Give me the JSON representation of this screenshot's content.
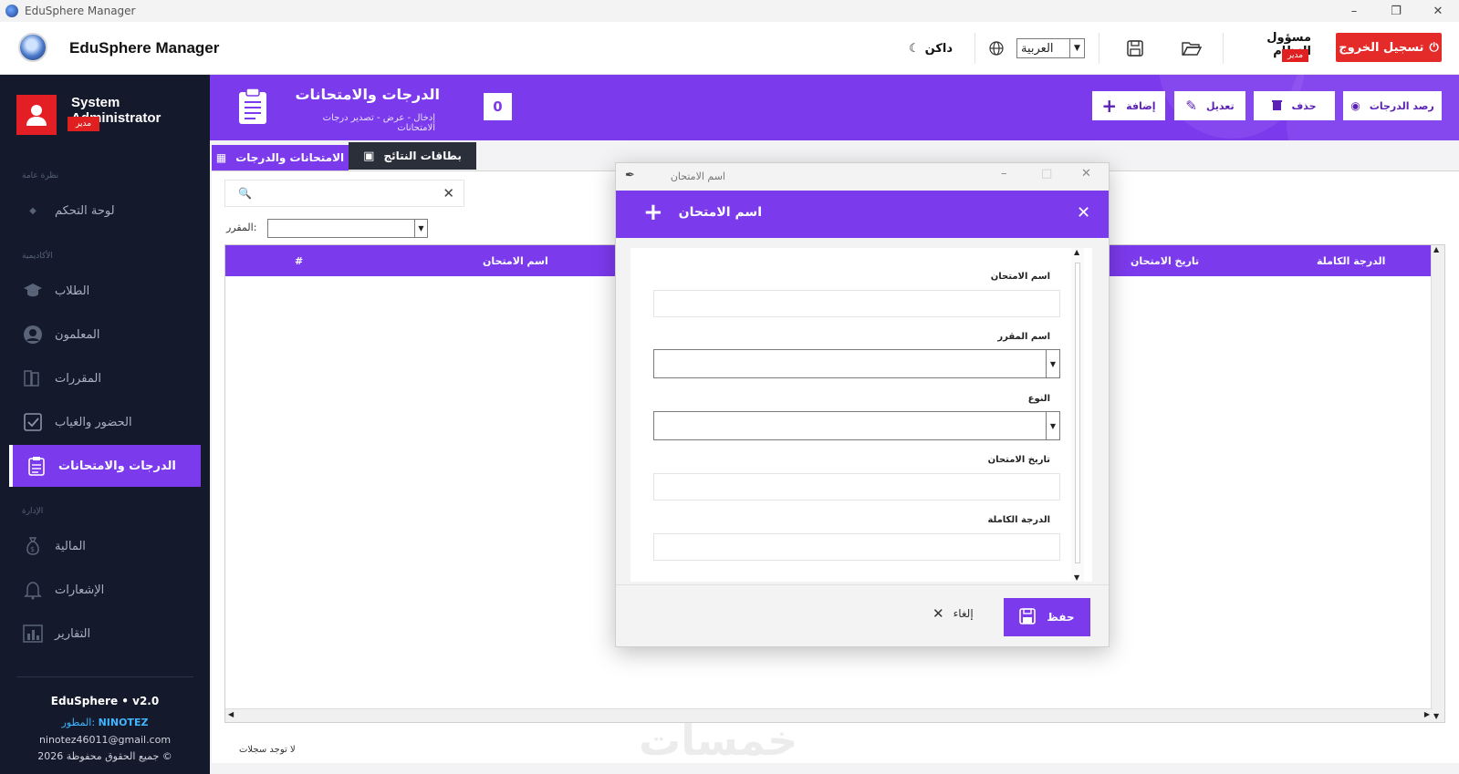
{
  "window": {
    "title": "EduSphere Manager"
  },
  "header": {
    "brand": "EduSphere Manager",
    "dark_mode_label": "داكن",
    "language": "العربية",
    "user_name": "مسؤول النظام",
    "user_role": "مدير",
    "logout_label": "تسجيل الخروج"
  },
  "sidebar": {
    "profile_name": "System Administrator",
    "profile_role": "مدير",
    "sections": [
      "نظرة عامة",
      "الأكاديمية",
      "الإدارة"
    ],
    "items": [
      {
        "label": "لوحة التحكم"
      },
      {
        "label": "الطلاب"
      },
      {
        "label": "المعلمون"
      },
      {
        "label": "المقررات"
      },
      {
        "label": "الحضور والغياب"
      },
      {
        "label": "الدرجات والامتحانات"
      },
      {
        "label": "المالية"
      },
      {
        "label": "الإشعارات"
      },
      {
        "label": "التقارير"
      }
    ],
    "footer": {
      "version": "EduSphere  •  v2.0",
      "developer_label": "المطور:",
      "developer_name": "NINOTEZ",
      "email": "ninotez46011@gmail.com",
      "copyright": "جميع الحقوق محفوظة 2026 ©"
    }
  },
  "page": {
    "title": "الدرجات والامتحانات",
    "subtitle": "إدخال - عرض - تصدير درجات الامتحانات",
    "count": "0",
    "toolbar": {
      "add": "إضافة",
      "edit": "تعديل",
      "delete": "حذف",
      "record_grades": "رصد الدرجات"
    },
    "tabs": [
      "الامتحانات والدرجات",
      "بطاقات النتائج"
    ],
    "filter_label": "المقرر:",
    "table_headers": [
      "#",
      "اسم الامتحان",
      "تاريخ الامتحان",
      "الدرجة الكاملة"
    ],
    "status": "لا توجد سجلات",
    "watermark": "خمسات"
  },
  "dialog": {
    "window_title": "اسم الامتحان",
    "header_title": "اسم الامتحان",
    "fields": [
      {
        "label": "اسم الامتحان",
        "value": ""
      },
      {
        "label": "اسم المقرر",
        "value": ""
      },
      {
        "label": "النوع",
        "value": ""
      },
      {
        "label": "تاريخ الامتحان",
        "value": ""
      },
      {
        "label": "الدرجة الكاملة",
        "value": ""
      }
    ],
    "cancel_label": "إلغاء",
    "save_label": "حفظ"
  },
  "colors": {
    "accent": "#7c3aed",
    "danger": "#e52a2a",
    "sidebar_bg": "#141a2b"
  }
}
